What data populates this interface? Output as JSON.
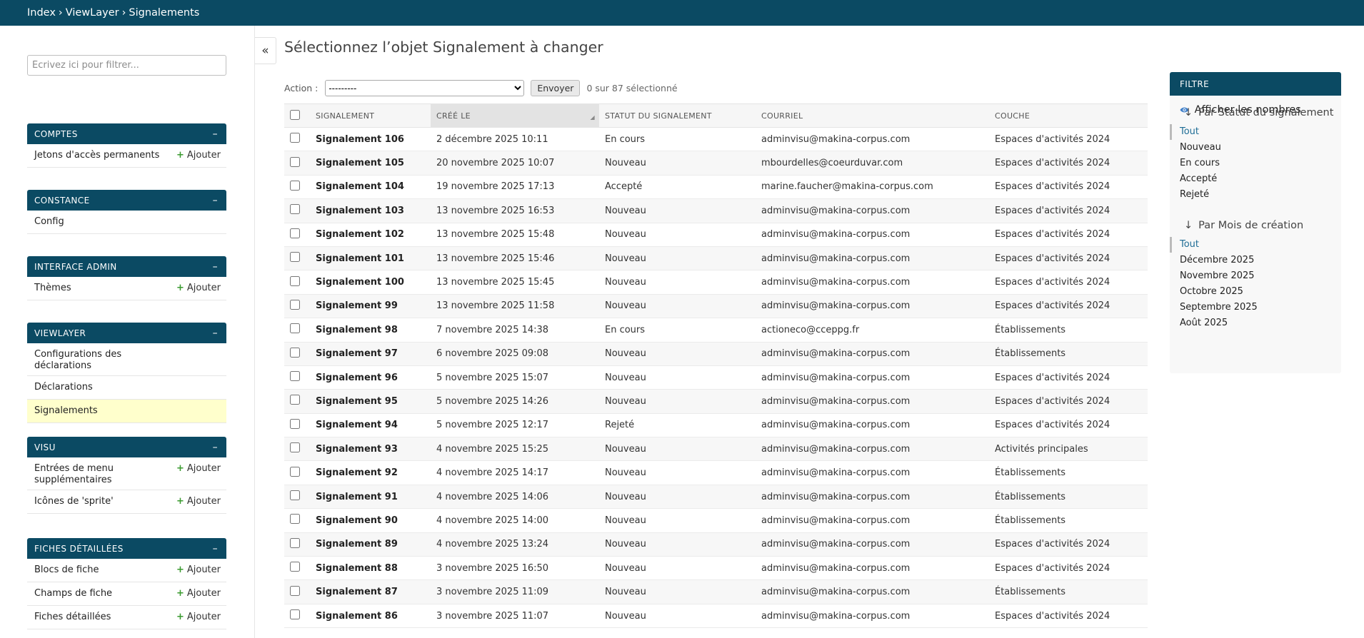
{
  "breadcrumb": {
    "home": "Index",
    "app": "ViewLayer",
    "current": "Signalements",
    "separator": "›"
  },
  "sidebar": {
    "filter_placeholder": "Écrivez ici pour filtrer...",
    "toggle_icon": "«",
    "collapse_icon": "–",
    "add_label": "Ajouter",
    "modules": [
      {
        "title": "COMPTES",
        "items": [
          {
            "label": "Jetons d'accès permanents",
            "has_add": true
          }
        ]
      },
      {
        "title": "CONSTANCE",
        "items": [
          {
            "label": "Config",
            "has_add": false
          }
        ]
      },
      {
        "title": "INTERFACE ADMIN",
        "items": [
          {
            "label": "Thèmes",
            "has_add": true
          }
        ]
      },
      {
        "title": "VIEWLAYER",
        "items": [
          {
            "label": "Configurations des déclarations",
            "has_add": false
          },
          {
            "label": "Déclarations",
            "has_add": false
          },
          {
            "label": "Signalements",
            "has_add": false,
            "active": true
          }
        ]
      },
      {
        "title": "VISU",
        "items": [
          {
            "label": "Entrées de menu supplémentaires",
            "has_add": true
          },
          {
            "label": "Icônes de 'sprite'",
            "has_add": true
          }
        ]
      },
      {
        "title": "FICHES DÉTAILLÉES",
        "items": [
          {
            "label": "Blocs de fiche",
            "has_add": true
          },
          {
            "label": "Champs de fiche",
            "has_add": true
          },
          {
            "label": "Fiches détaillées",
            "has_add": true
          }
        ]
      }
    ]
  },
  "main": {
    "title": "Sélectionnez l’objet Signalement à changer",
    "action_label": "Action :",
    "action_selected": "---------",
    "go_label": "Envoyer",
    "selection_count": "0 sur 87 sélectionné",
    "columns": [
      "SIGNALEMENT",
      "CRÉÉ LE",
      "STATUT DU SIGNALEMENT",
      "COURRIEL",
      "COUCHE"
    ],
    "sort_icon": "◢",
    "rows": [
      [
        "Signalement 106",
        "2 décembre 2025 10:11",
        "En cours",
        "adminvisu@makina-corpus.com",
        "Espaces d'activités 2024"
      ],
      [
        "Signalement 105",
        "20 novembre 2025 10:07",
        "Nouveau",
        "mbourdelles@coeurduvar.com",
        "Espaces d'activités 2024"
      ],
      [
        "Signalement 104",
        "19 novembre 2025 17:13",
        "Accepté",
        "marine.faucher@makina-corpus.com",
        "Espaces d'activités 2024"
      ],
      [
        "Signalement 103",
        "13 novembre 2025 16:53",
        "Nouveau",
        "adminvisu@makina-corpus.com",
        "Espaces d'activités 2024"
      ],
      [
        "Signalement 102",
        "13 novembre 2025 15:48",
        "Nouveau",
        "adminvisu@makina-corpus.com",
        "Espaces d'activités 2024"
      ],
      [
        "Signalement 101",
        "13 novembre 2025 15:46",
        "Nouveau",
        "adminvisu@makina-corpus.com",
        "Espaces d'activités 2024"
      ],
      [
        "Signalement 100",
        "13 novembre 2025 15:45",
        "Nouveau",
        "adminvisu@makina-corpus.com",
        "Espaces d'activités 2024"
      ],
      [
        "Signalement 99",
        "13 novembre 2025 11:58",
        "Nouveau",
        "adminvisu@makina-corpus.com",
        "Espaces d'activités 2024"
      ],
      [
        "Signalement 98",
        "7 novembre 2025 14:38",
        "En cours",
        "actioneco@cceppg.fr",
        "Établissements"
      ],
      [
        "Signalement 97",
        "6 novembre 2025 09:08",
        "Nouveau",
        "adminvisu@makina-corpus.com",
        "Établissements"
      ],
      [
        "Signalement 96",
        "5 novembre 2025 15:07",
        "Nouveau",
        "adminvisu@makina-corpus.com",
        "Espaces d'activités 2024"
      ],
      [
        "Signalement 95",
        "5 novembre 2025 14:26",
        "Nouveau",
        "adminvisu@makina-corpus.com",
        "Espaces d'activités 2024"
      ],
      [
        "Signalement 94",
        "5 novembre 2025 12:17",
        "Rejeté",
        "adminvisu@makina-corpus.com",
        "Espaces d'activités 2024"
      ],
      [
        "Signalement 93",
        "4 novembre 2025 15:25",
        "Nouveau",
        "adminvisu@makina-corpus.com",
        "Activités principales"
      ],
      [
        "Signalement 92",
        "4 novembre 2025 14:17",
        "Nouveau",
        "adminvisu@makina-corpus.com",
        "Établissements"
      ],
      [
        "Signalement 91",
        "4 novembre 2025 14:06",
        "Nouveau",
        "adminvisu@makina-corpus.com",
        "Établissements"
      ],
      [
        "Signalement 90",
        "4 novembre 2025 14:00",
        "Nouveau",
        "adminvisu@makina-corpus.com",
        "Établissements"
      ],
      [
        "Signalement 89",
        "4 novembre 2025 13:24",
        "Nouveau",
        "adminvisu@makina-corpus.com",
        "Espaces d'activités 2024"
      ],
      [
        "Signalement 88",
        "3 novembre 2025 16:50",
        "Nouveau",
        "adminvisu@makina-corpus.com",
        "Espaces d'activités 2024"
      ],
      [
        "Signalement 87",
        "3 novembre 2025 11:09",
        "Nouveau",
        "adminvisu@makina-corpus.com",
        "Établissements"
      ],
      [
        "Signalement 86",
        "3 novembre 2025 11:07",
        "Nouveau",
        "adminvisu@makina-corpus.com",
        "Espaces d'activités 2024"
      ]
    ]
  },
  "filter": {
    "title": "FILTRE",
    "show_counts": "Afficher les nombres",
    "eye_icon": "eye-icon",
    "arrow": "↓",
    "groups": [
      {
        "title": "Par Statut du signalement",
        "options": [
          "Tout",
          "Nouveau",
          "En cours",
          "Accepté",
          "Rejeté"
        ],
        "selected": 0
      },
      {
        "title": "Par Mois de création",
        "options": [
          "Tout",
          "Décembre 2025",
          "Novembre 2025",
          "Octobre 2025",
          "Septembre 2025",
          "Août 2025"
        ],
        "selected": 0
      }
    ]
  },
  "colors": {
    "header": "#0b4a63",
    "active_row": "#ffffcc",
    "add_plus": "#3a9a2f",
    "link_selected": "#1f6d96"
  }
}
